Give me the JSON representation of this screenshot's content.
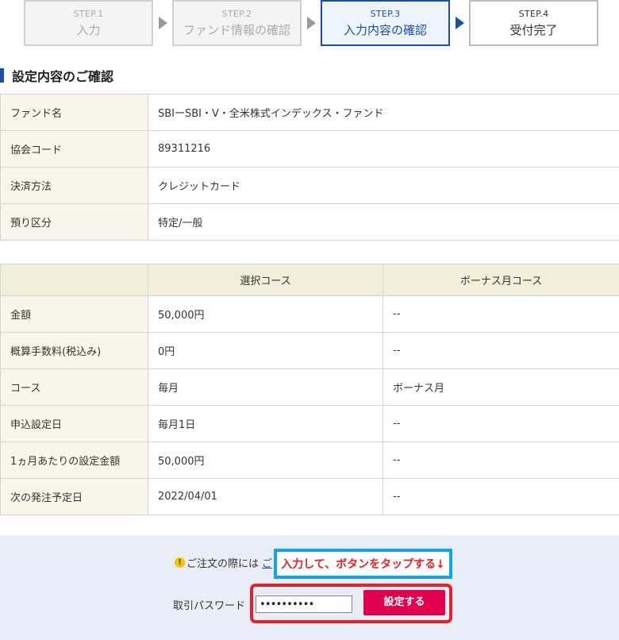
{
  "steps": [
    {
      "num": "STEP.1",
      "label": "入力"
    },
    {
      "num": "STEP.2",
      "label": "ファンド情報の確認"
    },
    {
      "num": "STEP.3",
      "label": "入力内容の確認"
    },
    {
      "num": "STEP.4",
      "label": "受付完了"
    }
  ],
  "section_title": "設定内容のご確認",
  "info": {
    "fund_name_label": "ファンド名",
    "fund_name": "SBIーSBI・V・全米株式インデックス・ファンド",
    "association_code_label": "協会コード",
    "association_code": "89311216",
    "payment_method_label": "決済方法",
    "payment_method": "クレジットカード",
    "custody_label": "預り区分",
    "custody": "特定/一般"
  },
  "course_table": {
    "headers": [
      "",
      "選択コース",
      "ボーナス月コース"
    ],
    "rows": [
      {
        "label": "金額",
        "selected": "50,000円",
        "bonus": "--"
      },
      {
        "label": "概算手数料(税込み)",
        "selected": "0円",
        "bonus": "--"
      },
      {
        "label": "コース",
        "selected": "毎月",
        "bonus": "ボーナス月"
      },
      {
        "label": "申込設定日",
        "selected": "毎月1日",
        "bonus": "--"
      },
      {
        "label": "1ヵ月あたりの設定金額",
        "selected": "50,000円",
        "bonus": "--"
      },
      {
        "label": "次の発注予定日",
        "selected": "2022/04/01",
        "bonus": "--"
      }
    ]
  },
  "notice": {
    "icon": "!",
    "text": "ご注文の際には",
    "link": "ご"
  },
  "callout": "入力して、ボタンをタップする↓",
  "password": {
    "label": "取引パスワード",
    "value": "••••••••••"
  },
  "submit_label": "設定する",
  "colors": {
    "accent": "#1a4fa3",
    "submit": "#e0004d",
    "callout_border": "#12a2ee",
    "highlight": "#e8202a"
  }
}
